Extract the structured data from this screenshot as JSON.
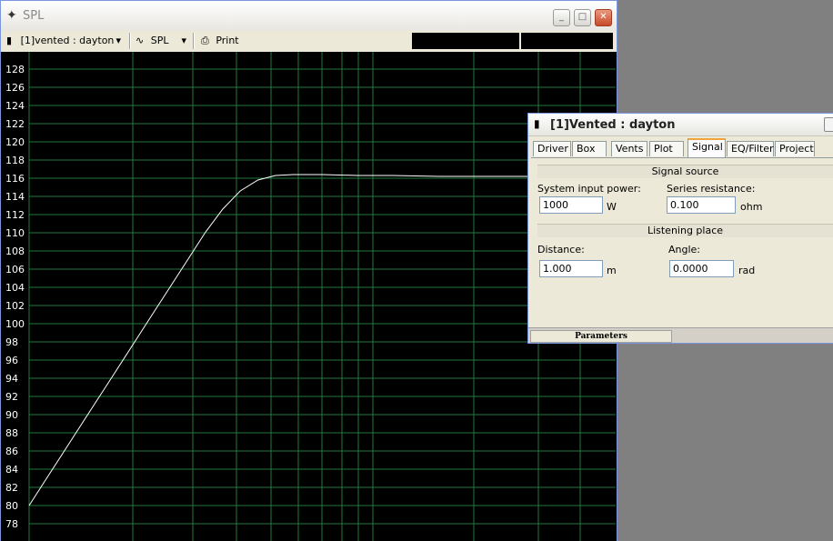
{
  "spl_window": {
    "title": "SPL",
    "toolbar": {
      "project_selector": "[1]vented : dayton",
      "graph_selector": "SPL",
      "print_label": "Print"
    }
  },
  "chart_data": {
    "type": "line",
    "y_ticks": [
      "128",
      "126",
      "124",
      "122",
      "120",
      "118",
      "116",
      "114",
      "112",
      "110",
      "108",
      "106",
      "104",
      "102",
      "100",
      "98",
      "96",
      "94",
      "92",
      "90",
      "88",
      "86",
      "84",
      "82",
      "80",
      "78"
    ],
    "ylim": [
      77,
      129
    ],
    "series": [
      {
        "color": "#ffffff",
        "points": [
          [
            0,
            80
          ],
          [
            0.03,
            83
          ],
          [
            0.06,
            86
          ],
          [
            0.09,
            89
          ],
          [
            0.12,
            92
          ],
          [
            0.15,
            95
          ],
          [
            0.18,
            98
          ],
          [
            0.21,
            101
          ],
          [
            0.24,
            104
          ],
          [
            0.27,
            107
          ],
          [
            0.3,
            110
          ],
          [
            0.33,
            112.6
          ],
          [
            0.36,
            114.6
          ],
          [
            0.39,
            115.8
          ],
          [
            0.42,
            116.3
          ],
          [
            0.45,
            116.4
          ],
          [
            0.5,
            116.4
          ],
          [
            0.56,
            116.3
          ],
          [
            0.62,
            116.3
          ],
          [
            0.7,
            116.2
          ],
          [
            0.8,
            116.2
          ],
          [
            0.9,
            116.2
          ],
          [
            1.0,
            116.2
          ]
        ]
      }
    ],
    "grid": true,
    "grid_color": "#1f7a3a",
    "background": "#000000"
  },
  "props_window": {
    "title": "[1]Vented : dayton",
    "tabs": [
      "Driver",
      "Box",
      "Vents",
      "Plot",
      "Signal",
      "EQ/Filter",
      "Project"
    ],
    "active_tab": "Signal",
    "signal_source": {
      "heading": "Signal source",
      "power_label": "System input power:",
      "power_value": "1000",
      "power_unit": "W",
      "resistance_label": "Series resistance:",
      "resistance_value": "0.100",
      "resistance_unit": "ohm"
    },
    "listening_place": {
      "heading": "Listening place",
      "distance_label": "Distance:",
      "distance_value": "1.000",
      "distance_unit": "m",
      "angle_label": "Angle:",
      "angle_value": "0.0000",
      "angle_unit": "rad"
    },
    "status": "Parameters"
  }
}
